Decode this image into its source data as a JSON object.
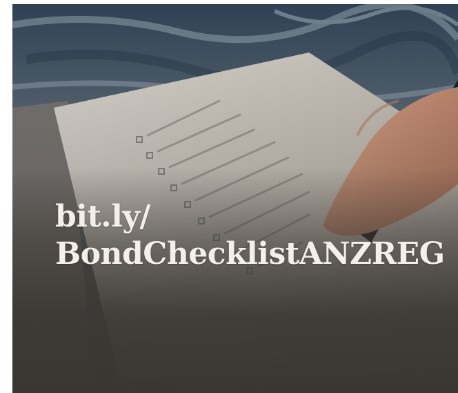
{
  "caption": {
    "line1": "bit.ly/",
    "line2": "BondChecklistANZREG"
  },
  "colors": {
    "text": "#f4efe8",
    "overlay_dark": "#3b3733",
    "fabric": "#3d4e5c"
  }
}
